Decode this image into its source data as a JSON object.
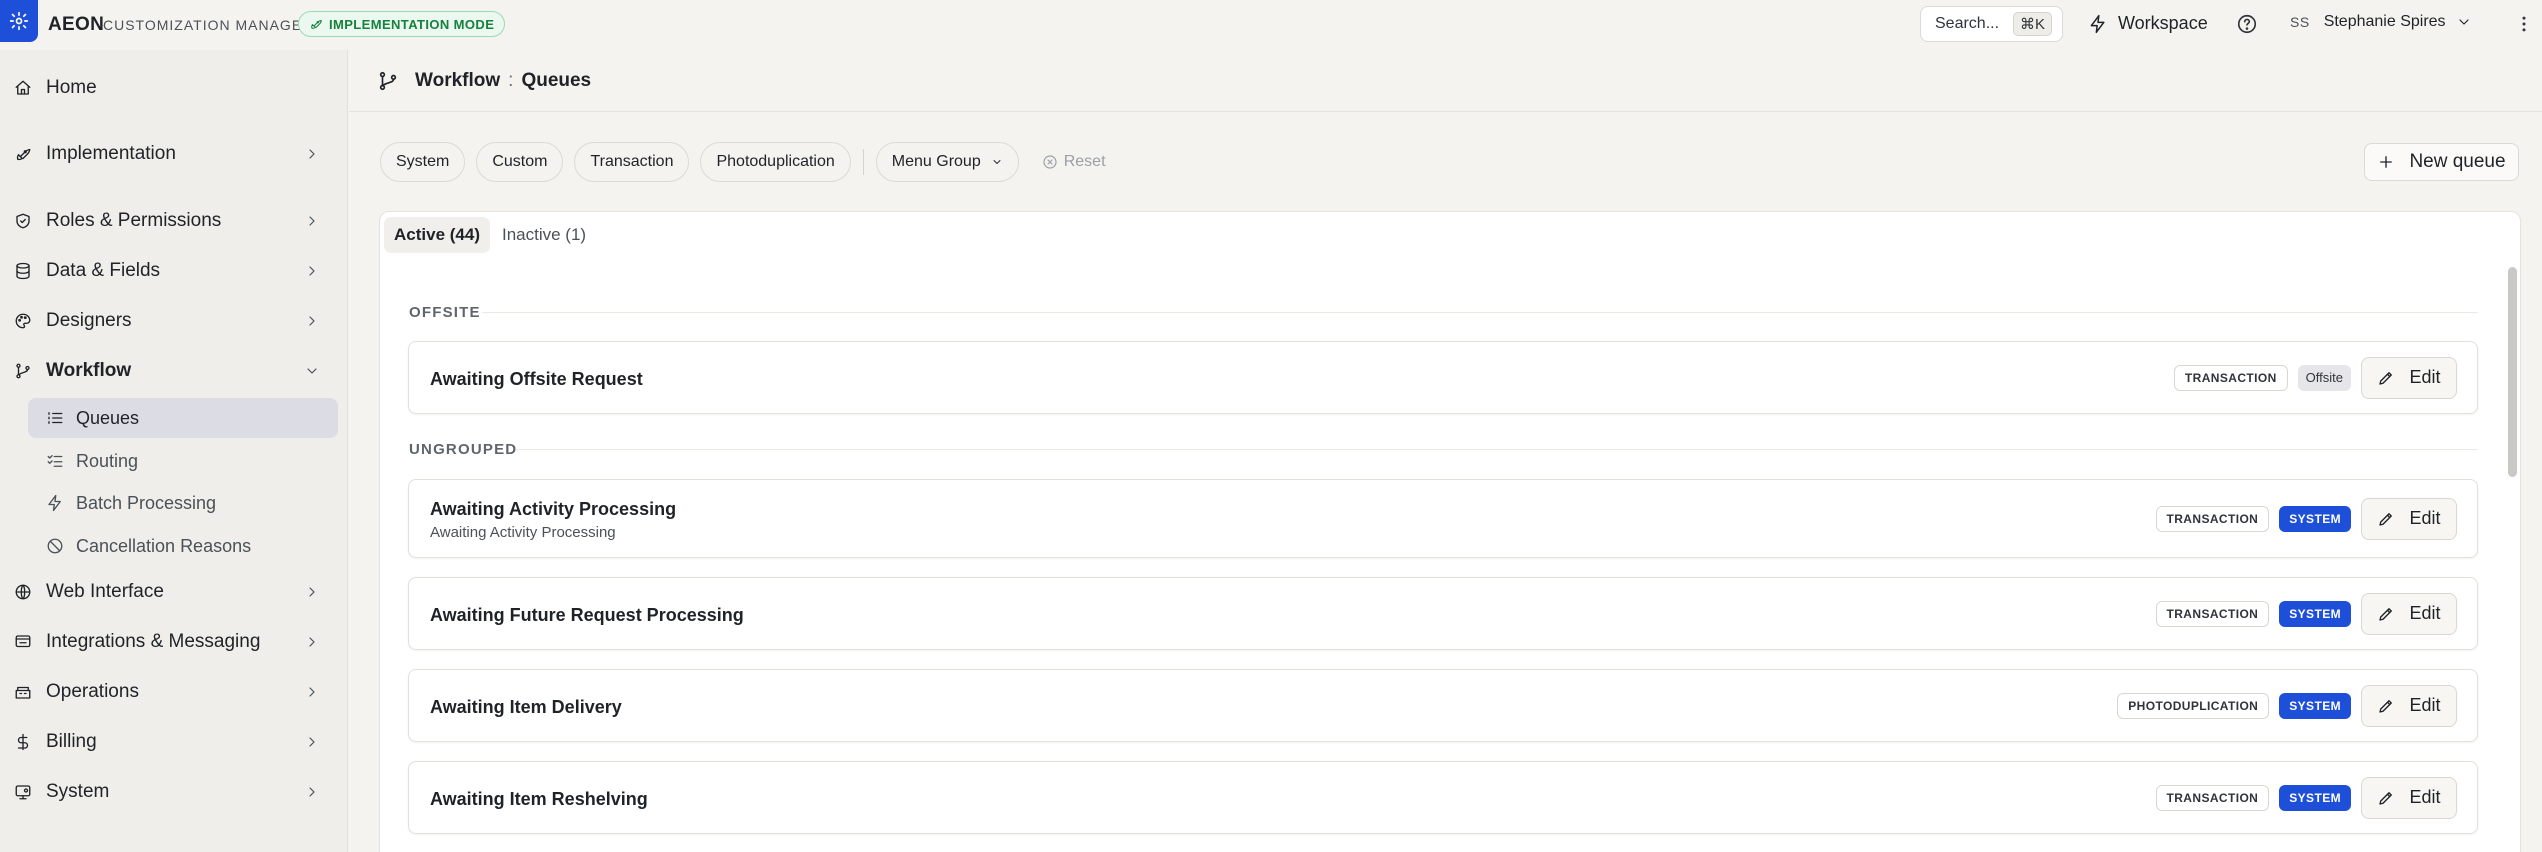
{
  "app": {
    "brand": "AEON",
    "subtitle": "CUSTOMIZATION MANAGER",
    "mode_badge": "IMPLEMENTATION MODE"
  },
  "topbar": {
    "search_label": "Search...",
    "search_shortcut": "⌘K",
    "workspace_label": "Workspace",
    "user_initials": "SS",
    "user_name": "Stephanie Spires"
  },
  "sidebar": {
    "items": [
      {
        "label": "Home",
        "icon": "home-icon"
      },
      {
        "label": "Implementation",
        "icon": "rocket-icon"
      },
      {
        "label": "Roles & Permissions",
        "icon": "shield-icon"
      },
      {
        "label": "Data & Fields",
        "icon": "database-icon"
      },
      {
        "label": "Designers",
        "icon": "palette-icon"
      },
      {
        "label": "Workflow",
        "icon": "workflow-icon"
      },
      {
        "label": "Web Interface",
        "icon": "globe-icon"
      },
      {
        "label": "Integrations & Messaging",
        "icon": "integrations-icon"
      },
      {
        "label": "Operations",
        "icon": "operations-icon"
      },
      {
        "label": "Billing",
        "icon": "dollar-icon"
      },
      {
        "label": "System",
        "icon": "system-icon"
      }
    ],
    "workflow_children": [
      {
        "label": "Queues",
        "icon": "list-icon",
        "active": true
      },
      {
        "label": "Routing",
        "icon": "checklist-icon"
      },
      {
        "label": "Batch Processing",
        "icon": "lightning-icon"
      },
      {
        "label": "Cancellation Reasons",
        "icon": "ban-icon"
      }
    ]
  },
  "breadcrumb": {
    "section": "Workflow",
    "separator": ":",
    "page": "Queues"
  },
  "filters": {
    "chips": [
      "System",
      "Custom",
      "Transaction",
      "Photoduplication"
    ],
    "menu_group": "Menu Group",
    "reset": "Reset"
  },
  "new_queue_label": "New queue",
  "tabs": [
    {
      "label": "Active (44)",
      "active": true
    },
    {
      "label": "Inactive (1)",
      "active": false
    }
  ],
  "groups": [
    {
      "label": "OFFSITE"
    },
    {
      "label": "UNGROUPED"
    }
  ],
  "queues": [
    {
      "title": "Awaiting Offsite Request",
      "subtitle": "",
      "type": "TRANSACTION",
      "tag": "Offsite",
      "edit": "Edit"
    },
    {
      "title": "Awaiting Activity Processing",
      "subtitle": "Awaiting Activity Processing",
      "type": "TRANSACTION",
      "tag": "SYSTEM",
      "edit": "Edit"
    },
    {
      "title": "Awaiting Future Request Processing",
      "subtitle": "",
      "type": "TRANSACTION",
      "tag": "SYSTEM",
      "edit": "Edit"
    },
    {
      "title": "Awaiting Item Delivery",
      "subtitle": "",
      "type": "PHOTODUPLICATION",
      "tag": "SYSTEM",
      "edit": "Edit"
    },
    {
      "title": "Awaiting Item Reshelving",
      "subtitle": "",
      "type": "TRANSACTION",
      "tag": "SYSTEM",
      "edit": "Edit"
    }
  ],
  "colors": {
    "accent": "#1d4fd8",
    "mode_green": "#16803c",
    "active_nav_bg": "#dcdde4"
  }
}
